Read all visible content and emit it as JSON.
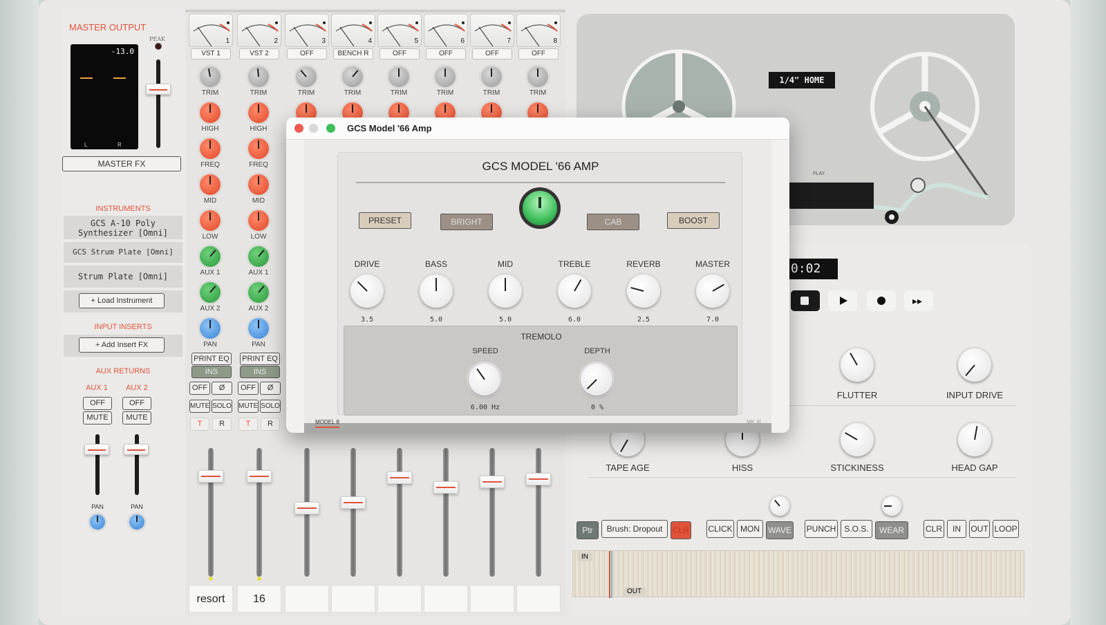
{
  "master": {
    "title": "MASTER OUTPUT",
    "peak_label": "PEAK",
    "meter_readout": "-13.0",
    "meter_l": "L",
    "meter_r": "R",
    "master_fx": "MASTER FX",
    "instruments_title": "INSTRUMENTS",
    "instruments": [
      "GCS A-10 Poly Synthesizer [Omni]",
      "GCS Strum Plate [Omni]",
      "Strum Plate [Omni]"
    ],
    "load_instrument": "+ Load Instrument",
    "input_inserts_title": "INPUT INSERTS",
    "add_insert": "+ Add Insert FX",
    "aux_returns_title": "AUX RETURNS",
    "aux": [
      {
        "name": "AUX 1",
        "off": "OFF",
        "mute": "MUTE",
        "pan": "PAN"
      },
      {
        "name": "AUX 2",
        "off": "OFF",
        "mute": "MUTE",
        "pan": "PAN"
      }
    ]
  },
  "channels": [
    {
      "num": "1",
      "name": "VST 1",
      "bottom": "resort"
    },
    {
      "num": "2",
      "name": "VST 2",
      "bottom": "16"
    },
    {
      "num": "3",
      "name": "OFF",
      "bottom": ""
    },
    {
      "num": "4",
      "name": "BENCH R",
      "bottom": ""
    },
    {
      "num": "5",
      "name": "OFF",
      "bottom": ""
    },
    {
      "num": "6",
      "name": "OFF",
      "bottom": ""
    },
    {
      "num": "7",
      "name": "OFF",
      "bottom": ""
    },
    {
      "num": "8",
      "name": "OFF",
      "bottom": ""
    }
  ],
  "strip_labels": {
    "trim": "TRIM",
    "high": "HIGH",
    "freq": "FREQ",
    "mid": "MID",
    "low": "LOW",
    "aux1": "AUX 1",
    "aux2": "AUX 2",
    "pan": "PAN",
    "print_eq": "PRINT EQ",
    "ins": "INS",
    "off": "OFF",
    "phase": "Ø",
    "mute": "MUTE",
    "solo": "SOLO",
    "t": "T",
    "r": "R"
  },
  "tape": {
    "reel_label": "1/4\" HOME",
    "play_label": "PLAY",
    "time": "0:02",
    "knobs": {
      "flutter": "FLUTTER",
      "input_drive": "INPUT DRIVE",
      "tape_age": "TAPE AGE",
      "hiss": "HISS",
      "stickiness": "STICKINESS",
      "head_gap": "HEAD GAP"
    },
    "tools": {
      "ptr": "Ptr",
      "brush": "Brush: Dropout",
      "clr": "CLR",
      "click": "CLICK",
      "mon": "MON",
      "wave": "WAVE",
      "punch": "PUNCH",
      "sos": "S.O.S.",
      "wear": "WEAR",
      "clr2": "CLR",
      "in": "IN",
      "out": "OUT",
      "loop": "LOOP"
    },
    "in_marker": "IN",
    "out_marker": "OUT"
  },
  "window": {
    "title": "GCS Model '66 Amp",
    "amp_title": "GCS MODEL '66 AMP",
    "buttons": {
      "preset": "PRESET",
      "bright": "BRIGHT",
      "cab": "CAB",
      "boost": "BOOST"
    },
    "knobs": [
      {
        "label": "DRIVE",
        "value": "3.5"
      },
      {
        "label": "BASS",
        "value": "5.0"
      },
      {
        "label": "MID",
        "value": "5.0"
      },
      {
        "label": "TREBLE",
        "value": "6.0"
      },
      {
        "label": "REVERB",
        "value": "2.5"
      },
      {
        "label": "MASTER",
        "value": "7.0"
      }
    ],
    "tremolo": {
      "title": "TREMOLO",
      "speed_label": "SPEED",
      "speed_value": "6.00 Hz",
      "depth_label": "DEPTH",
      "depth_value": "0 %"
    },
    "model_tag": "MODEL 8",
    "mk_tag": "MK III"
  },
  "colors": {
    "accent": "#e0533a",
    "green_led": "#3fbf5b",
    "panel": "#ebeae8"
  }
}
